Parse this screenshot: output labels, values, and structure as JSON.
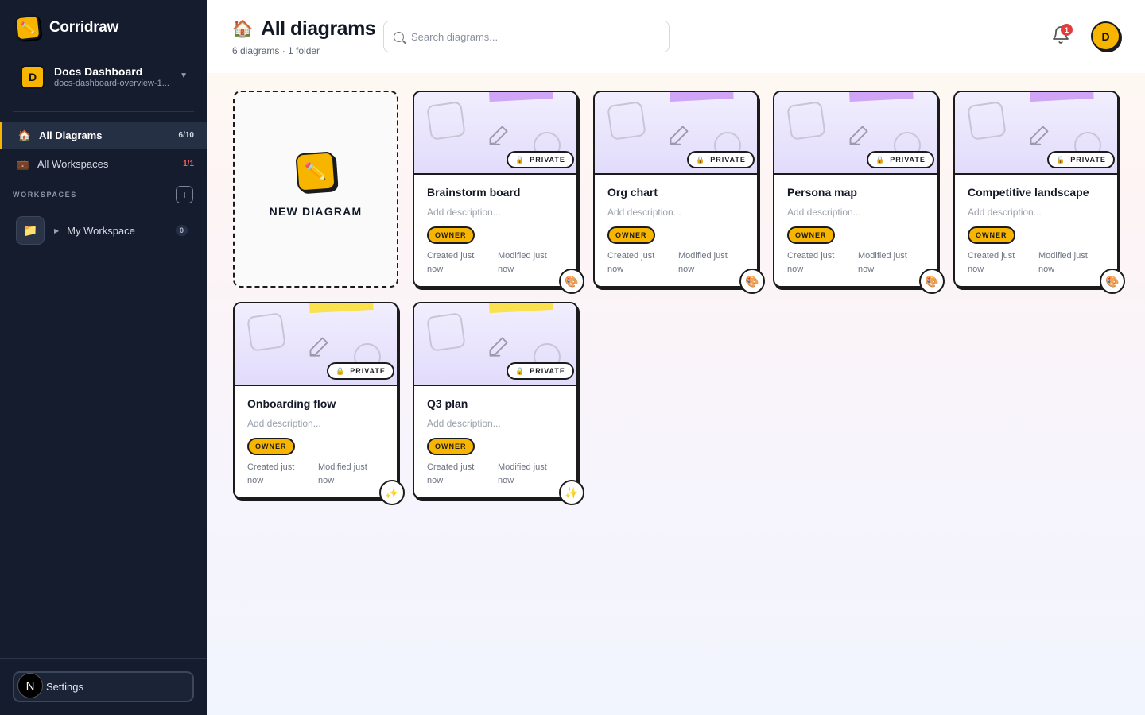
{
  "app": {
    "name": "Corridraw"
  },
  "workspace_switcher": {
    "initial": "D",
    "name": "Docs Dashboard",
    "slug": "docs-dashboard-overview-1..."
  },
  "nav": [
    {
      "label": "All Diagrams",
      "count": "6/10",
      "icon": "house-icon"
    },
    {
      "label": "All Workspaces",
      "count": "1/1",
      "icon": "briefcase-icon"
    }
  ],
  "workspaces": {
    "heading": "WORKSPACES",
    "add_label": "+",
    "items": [
      {
        "name": "My Workspace",
        "count": "0",
        "icon": "folder-icon"
      }
    ]
  },
  "settings": {
    "label": "Settings",
    "badge": "N"
  },
  "header": {
    "title": "All diagrams",
    "subtitle": "6 diagrams · 1 folder",
    "search_placeholder": "Search diagrams...",
    "notification_count": "1",
    "user_initial": "D"
  },
  "new_diagram": {
    "label": "NEW DIAGRAM"
  },
  "cards": [
    {
      "title": "Brainstorm board",
      "description": "Add description...",
      "visibility": "PRIVATE",
      "role": "OWNER",
      "created": "Created just now",
      "modified": "Modified just now",
      "tape": "purple",
      "corner_icon": "palette-icon"
    },
    {
      "title": "Org chart",
      "description": "Add description...",
      "visibility": "PRIVATE",
      "role": "OWNER",
      "created": "Created just now",
      "modified": "Modified just now",
      "tape": "purple",
      "corner_icon": "palette-icon"
    },
    {
      "title": "Persona map",
      "description": "Add description...",
      "visibility": "PRIVATE",
      "role": "OWNER",
      "created": "Created just now",
      "modified": "Modified just now",
      "tape": "purple",
      "corner_icon": "palette-icon"
    },
    {
      "title": "Competitive landscape",
      "description": "Add description...",
      "visibility": "PRIVATE",
      "role": "OWNER",
      "created": "Created just now",
      "modified": "Modified just now",
      "tape": "purple",
      "corner_icon": "palette-icon"
    },
    {
      "title": "Onboarding flow",
      "description": "Add description...",
      "visibility": "PRIVATE",
      "role": "OWNER",
      "created": "Created just now",
      "modified": "Modified just now",
      "tape": "yellow",
      "corner_icon": "sparkles-icon"
    },
    {
      "title": "Q3 plan",
      "description": "Add description...",
      "visibility": "PRIVATE",
      "role": "OWNER",
      "created": "Created just now",
      "modified": "Modified just now",
      "tape": "yellow",
      "corner_icon": "sparkles-icon"
    }
  ],
  "colors": {
    "sidebar_bg": "#141c2e",
    "accent": "#f7b500",
    "tape_purple": "#cc9cf5",
    "tape_yellow": "#fbe03c",
    "notification": "#e43b3b"
  }
}
